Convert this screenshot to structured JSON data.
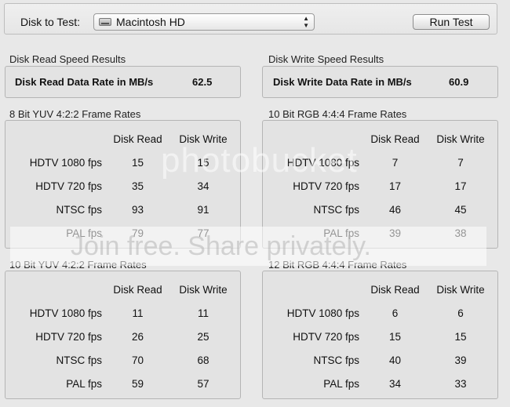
{
  "toolbar": {
    "disk_label": "Disk to Test:",
    "disk_value": "Macintosh HD",
    "run_label": "Run Test"
  },
  "read_summary": {
    "title": "Disk Read Speed Results",
    "label": "Disk Read Data Rate in MB/s",
    "value": "62.5"
  },
  "write_summary": {
    "title": "Disk Write Speed Results",
    "label": "Disk Write Data Rate in MB/s",
    "value": "60.9"
  },
  "columns": {
    "read": "Disk Read",
    "write": "Disk Write"
  },
  "panels": [
    {
      "title": "8 Bit YUV 4:2:2 Frame Rates",
      "rows": [
        {
          "label": "HDTV 1080 fps",
          "read": "15",
          "write": "15"
        },
        {
          "label": "HDTV 720 fps",
          "read": "35",
          "write": "34"
        },
        {
          "label": "NTSC fps",
          "read": "93",
          "write": "91"
        },
        {
          "label": "PAL fps",
          "read": "79",
          "write": "77"
        }
      ]
    },
    {
      "title": "10 Bit RGB 4:4:4 Frame Rates",
      "rows": [
        {
          "label": "HDTV 1080 fps",
          "read": "7",
          "write": "7"
        },
        {
          "label": "HDTV 720 fps",
          "read": "17",
          "write": "17"
        },
        {
          "label": "NTSC fps",
          "read": "46",
          "write": "45"
        },
        {
          "label": "PAL fps",
          "read": "39",
          "write": "38"
        }
      ]
    },
    {
      "title": "10 Bit YUV 4:2:2 Frame Rates",
      "rows": [
        {
          "label": "HDTV 1080 fps",
          "read": "11",
          "write": "11"
        },
        {
          "label": "HDTV 720 fps",
          "read": "26",
          "write": "25"
        },
        {
          "label": "NTSC fps",
          "read": "70",
          "write": "68"
        },
        {
          "label": "PAL fps",
          "read": "59",
          "write": "57"
        }
      ]
    },
    {
      "title": "12 Bit RGB 4:4:4 Frame Rates",
      "rows": [
        {
          "label": "HDTV 1080 fps",
          "read": "6",
          "write": "6"
        },
        {
          "label": "HDTV 720 fps",
          "read": "15",
          "write": "15"
        },
        {
          "label": "NTSC fps",
          "read": "40",
          "write": "39"
        },
        {
          "label": "PAL fps",
          "read": "34",
          "write": "33"
        }
      ]
    }
  ],
  "watermark": {
    "line1": "photobucket",
    "line2": "Join free. Share privately."
  },
  "icons": {
    "disk": "hard-drive-icon",
    "popup_arrows": "up-down-arrows-icon"
  }
}
